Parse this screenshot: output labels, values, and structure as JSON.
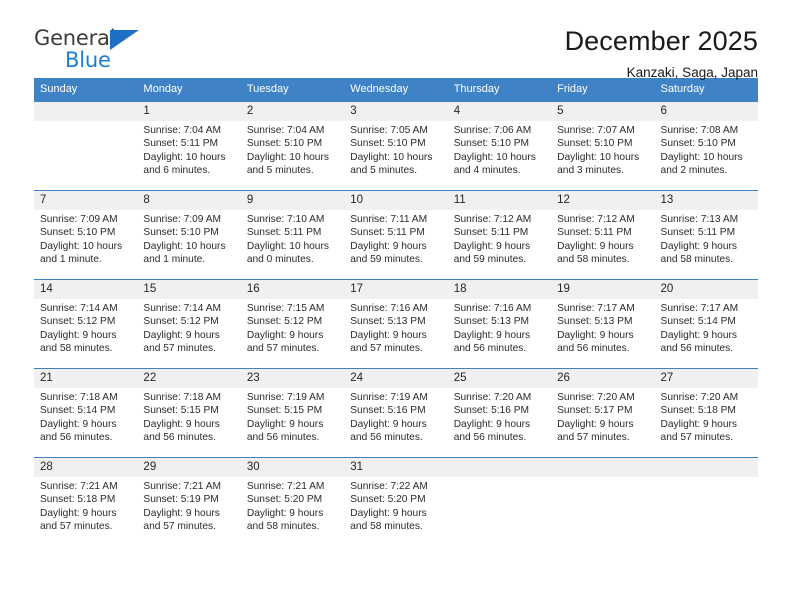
{
  "logo": {
    "primary_text": "General",
    "secondary_text": "Blue",
    "primary_color": "#3c3c3c",
    "secondary_color": "#1a7fd4",
    "triangle_color": "#1f6fc4"
  },
  "header": {
    "title": "December 2025",
    "subtitle": "Kanzaki, Saga, Japan"
  },
  "theme": {
    "header_band_color": "#3f83c6",
    "daynum_band_color": "#f0f0f0",
    "text_color": "#2b2b2b"
  },
  "calendar": {
    "weekdays": [
      "Sunday",
      "Monday",
      "Tuesday",
      "Wednesday",
      "Thursday",
      "Friday",
      "Saturday"
    ],
    "weeks": [
      [
        {
          "day": "",
          "sunrise": "",
          "sunset": "",
          "daylight": ""
        },
        {
          "day": "1",
          "sunrise": "Sunrise: 7:04 AM",
          "sunset": "Sunset: 5:11 PM",
          "daylight": "Daylight: 10 hours and 6 minutes."
        },
        {
          "day": "2",
          "sunrise": "Sunrise: 7:04 AM",
          "sunset": "Sunset: 5:10 PM",
          "daylight": "Daylight: 10 hours and 5 minutes."
        },
        {
          "day": "3",
          "sunrise": "Sunrise: 7:05 AM",
          "sunset": "Sunset: 5:10 PM",
          "daylight": "Daylight: 10 hours and 5 minutes."
        },
        {
          "day": "4",
          "sunrise": "Sunrise: 7:06 AM",
          "sunset": "Sunset: 5:10 PM",
          "daylight": "Daylight: 10 hours and 4 minutes."
        },
        {
          "day": "5",
          "sunrise": "Sunrise: 7:07 AM",
          "sunset": "Sunset: 5:10 PM",
          "daylight": "Daylight: 10 hours and 3 minutes."
        },
        {
          "day": "6",
          "sunrise": "Sunrise: 7:08 AM",
          "sunset": "Sunset: 5:10 PM",
          "daylight": "Daylight: 10 hours and 2 minutes."
        }
      ],
      [
        {
          "day": "7",
          "sunrise": "Sunrise: 7:09 AM",
          "sunset": "Sunset: 5:10 PM",
          "daylight": "Daylight: 10 hours and 1 minute."
        },
        {
          "day": "8",
          "sunrise": "Sunrise: 7:09 AM",
          "sunset": "Sunset: 5:10 PM",
          "daylight": "Daylight: 10 hours and 1 minute."
        },
        {
          "day": "9",
          "sunrise": "Sunrise: 7:10 AM",
          "sunset": "Sunset: 5:11 PM",
          "daylight": "Daylight: 10 hours and 0 minutes."
        },
        {
          "day": "10",
          "sunrise": "Sunrise: 7:11 AM",
          "sunset": "Sunset: 5:11 PM",
          "daylight": "Daylight: 9 hours and 59 minutes."
        },
        {
          "day": "11",
          "sunrise": "Sunrise: 7:12 AM",
          "sunset": "Sunset: 5:11 PM",
          "daylight": "Daylight: 9 hours and 59 minutes."
        },
        {
          "day": "12",
          "sunrise": "Sunrise: 7:12 AM",
          "sunset": "Sunset: 5:11 PM",
          "daylight": "Daylight: 9 hours and 58 minutes."
        },
        {
          "day": "13",
          "sunrise": "Sunrise: 7:13 AM",
          "sunset": "Sunset: 5:11 PM",
          "daylight": "Daylight: 9 hours and 58 minutes."
        }
      ],
      [
        {
          "day": "14",
          "sunrise": "Sunrise: 7:14 AM",
          "sunset": "Sunset: 5:12 PM",
          "daylight": "Daylight: 9 hours and 58 minutes."
        },
        {
          "day": "15",
          "sunrise": "Sunrise: 7:14 AM",
          "sunset": "Sunset: 5:12 PM",
          "daylight": "Daylight: 9 hours and 57 minutes."
        },
        {
          "day": "16",
          "sunrise": "Sunrise: 7:15 AM",
          "sunset": "Sunset: 5:12 PM",
          "daylight": "Daylight: 9 hours and 57 minutes."
        },
        {
          "day": "17",
          "sunrise": "Sunrise: 7:16 AM",
          "sunset": "Sunset: 5:13 PM",
          "daylight": "Daylight: 9 hours and 57 minutes."
        },
        {
          "day": "18",
          "sunrise": "Sunrise: 7:16 AM",
          "sunset": "Sunset: 5:13 PM",
          "daylight": "Daylight: 9 hours and 56 minutes."
        },
        {
          "day": "19",
          "sunrise": "Sunrise: 7:17 AM",
          "sunset": "Sunset: 5:13 PM",
          "daylight": "Daylight: 9 hours and 56 minutes."
        },
        {
          "day": "20",
          "sunrise": "Sunrise: 7:17 AM",
          "sunset": "Sunset: 5:14 PM",
          "daylight": "Daylight: 9 hours and 56 minutes."
        }
      ],
      [
        {
          "day": "21",
          "sunrise": "Sunrise: 7:18 AM",
          "sunset": "Sunset: 5:14 PM",
          "daylight": "Daylight: 9 hours and 56 minutes."
        },
        {
          "day": "22",
          "sunrise": "Sunrise: 7:18 AM",
          "sunset": "Sunset: 5:15 PM",
          "daylight": "Daylight: 9 hours and 56 minutes."
        },
        {
          "day": "23",
          "sunrise": "Sunrise: 7:19 AM",
          "sunset": "Sunset: 5:15 PM",
          "daylight": "Daylight: 9 hours and 56 minutes."
        },
        {
          "day": "24",
          "sunrise": "Sunrise: 7:19 AM",
          "sunset": "Sunset: 5:16 PM",
          "daylight": "Daylight: 9 hours and 56 minutes."
        },
        {
          "day": "25",
          "sunrise": "Sunrise: 7:20 AM",
          "sunset": "Sunset: 5:16 PM",
          "daylight": "Daylight: 9 hours and 56 minutes."
        },
        {
          "day": "26",
          "sunrise": "Sunrise: 7:20 AM",
          "sunset": "Sunset: 5:17 PM",
          "daylight": "Daylight: 9 hours and 57 minutes."
        },
        {
          "day": "27",
          "sunrise": "Sunrise: 7:20 AM",
          "sunset": "Sunset: 5:18 PM",
          "daylight": "Daylight: 9 hours and 57 minutes."
        }
      ],
      [
        {
          "day": "28",
          "sunrise": "Sunrise: 7:21 AM",
          "sunset": "Sunset: 5:18 PM",
          "daylight": "Daylight: 9 hours and 57 minutes."
        },
        {
          "day": "29",
          "sunrise": "Sunrise: 7:21 AM",
          "sunset": "Sunset: 5:19 PM",
          "daylight": "Daylight: 9 hours and 57 minutes."
        },
        {
          "day": "30",
          "sunrise": "Sunrise: 7:21 AM",
          "sunset": "Sunset: 5:20 PM",
          "daylight": "Daylight: 9 hours and 58 minutes."
        },
        {
          "day": "31",
          "sunrise": "Sunrise: 7:22 AM",
          "sunset": "Sunset: 5:20 PM",
          "daylight": "Daylight: 9 hours and 58 minutes."
        },
        {
          "day": "",
          "sunrise": "",
          "sunset": "",
          "daylight": ""
        },
        {
          "day": "",
          "sunrise": "",
          "sunset": "",
          "daylight": ""
        },
        {
          "day": "",
          "sunrise": "",
          "sunset": "",
          "daylight": ""
        }
      ]
    ]
  }
}
